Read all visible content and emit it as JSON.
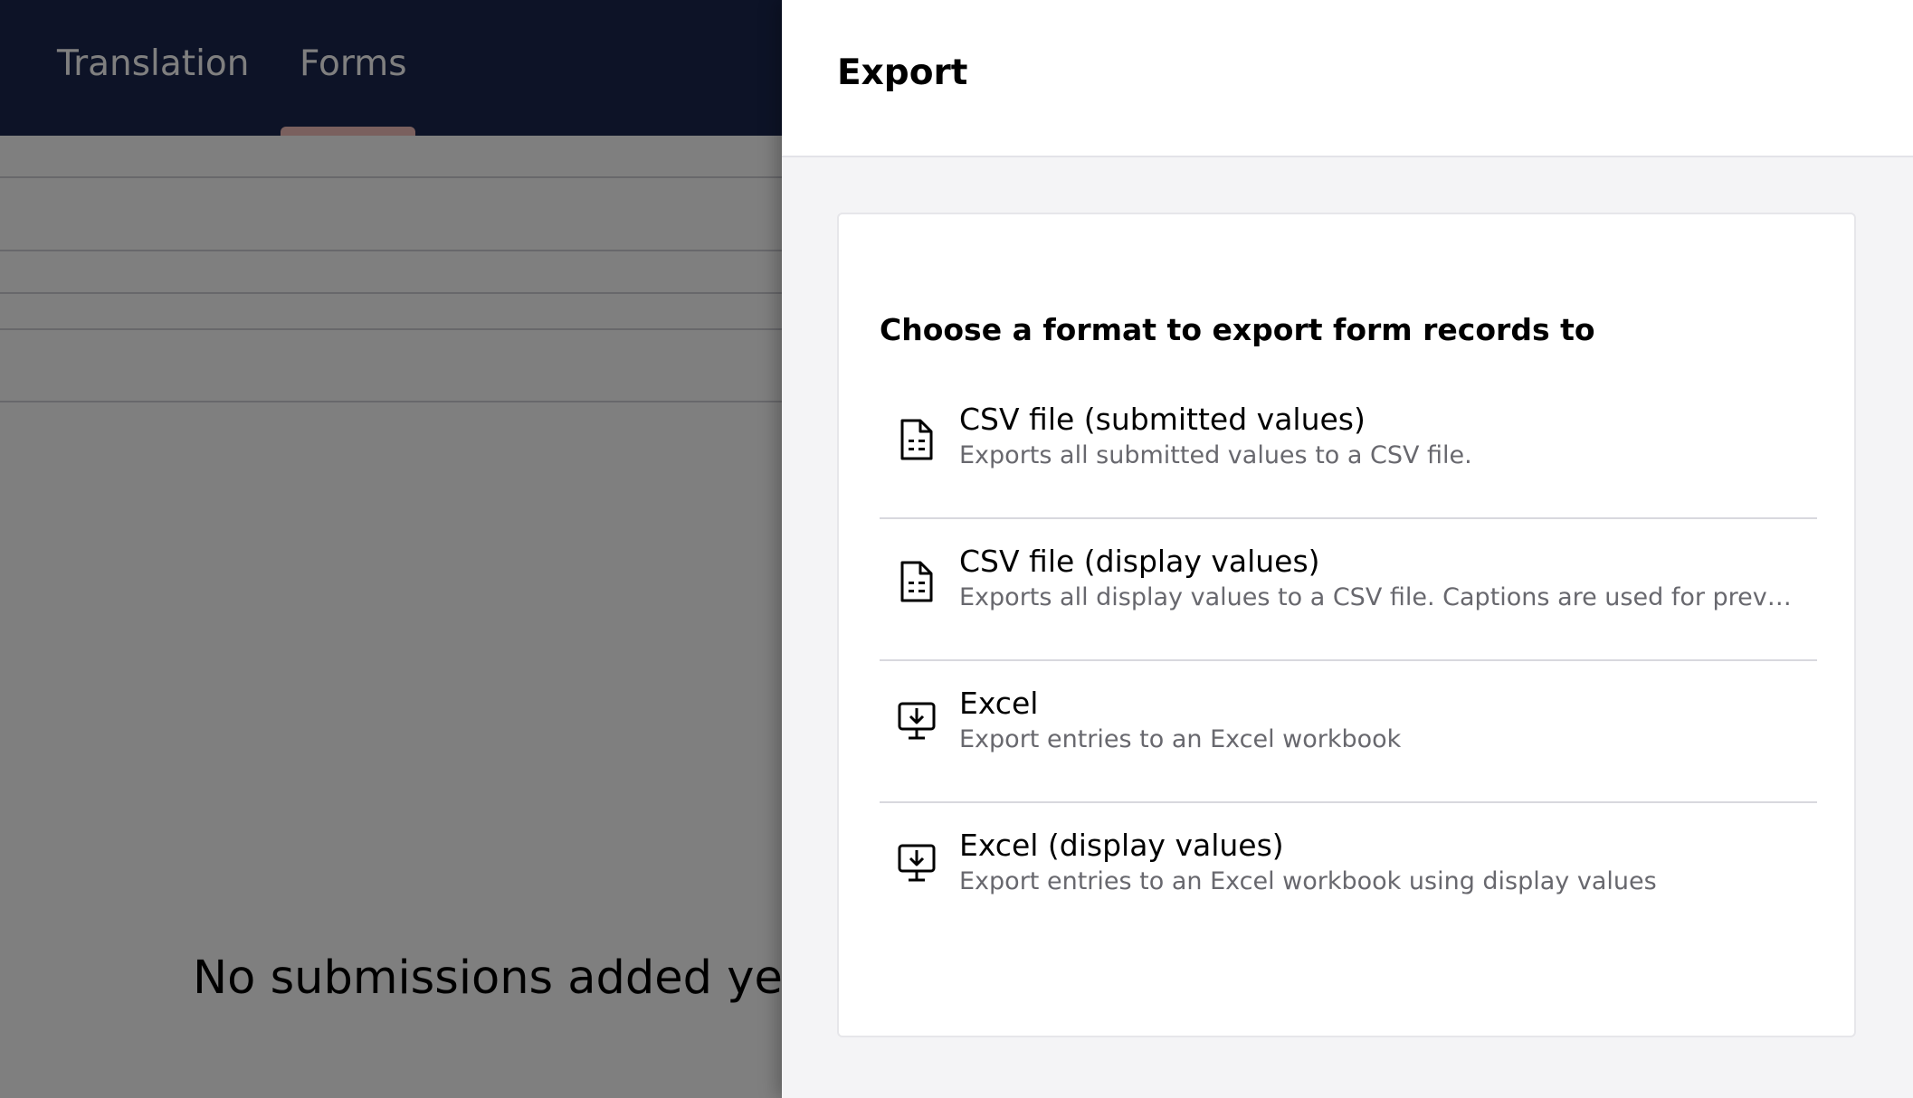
{
  "nav": {
    "tabs": [
      {
        "label": "Translation"
      },
      {
        "label": "Forms"
      }
    ]
  },
  "background": {
    "empty_message": "No submissions added yet in"
  },
  "panel": {
    "title": "Export",
    "heading": "Choose a format to export form records to",
    "options": [
      {
        "title": "CSV file (submitted values)",
        "description": "Exports all submitted values to a CSV file.",
        "icon": "csv-file-icon"
      },
      {
        "title": "CSV file (display values)",
        "description": "Exports all display values to a CSV file. Captions are used for prevalue d...",
        "icon": "csv-file-icon"
      },
      {
        "title": "Excel",
        "description": "Export entries to an Excel workbook",
        "icon": "monitor-download-icon"
      },
      {
        "title": "Excel (display values)",
        "description": "Export entries to an Excel workbook using display values",
        "icon": "monitor-download-icon"
      }
    ]
  },
  "colors": {
    "nav_bg": "#1b264f",
    "tab_indicator": "#f5c1bc",
    "panel_bg": "#f4f4f6",
    "description_text": "#68686e"
  }
}
